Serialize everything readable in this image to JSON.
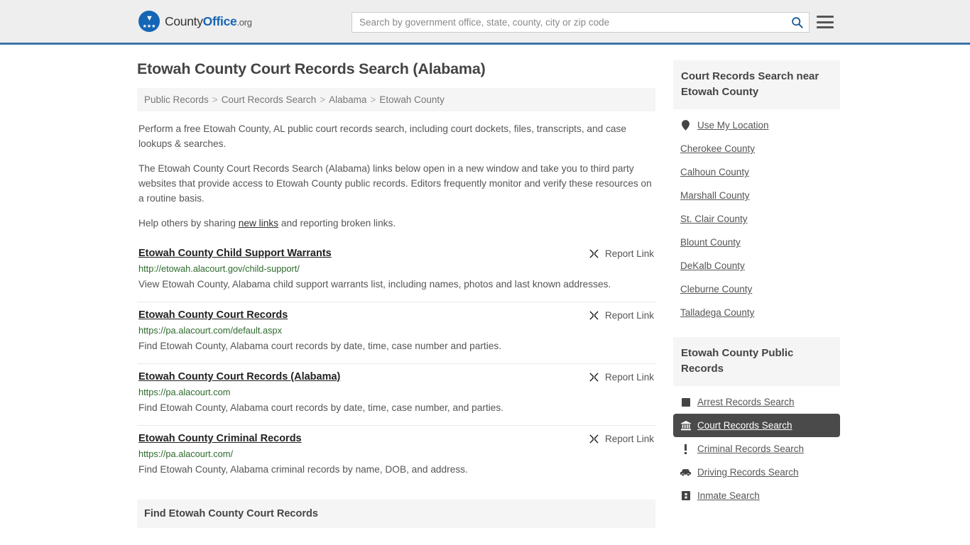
{
  "header": {
    "logo": {
      "icon": "eagle-seal-icon",
      "text_county": "County",
      "text_office": "Office",
      "text_org": ".org"
    },
    "search": {
      "placeholder": "Search by government office, state, county, city or zip code",
      "value": "",
      "icon": "search-icon"
    },
    "menu_icon": "hamburger-menu-icon",
    "accent_color": "#3b72a8"
  },
  "main": {
    "title": "Etowah County Court Records Search (Alabama)",
    "breadcrumb": [
      "Public Records",
      "Court Records Search",
      "Alabama",
      "Etowah County"
    ],
    "breadcrumb_separator": ">",
    "intro": [
      "Perform a free Etowah County, AL public court records search, including court dockets, files, transcripts, and case lookups & searches.",
      "The Etowah County Court Records Search (Alabama) links below open in a new window and take you to third party websites that provide access to Etowah County public records. Editors frequently monitor and verify these resources on a routine basis."
    ],
    "help_prefix": "Help others by sharing ",
    "help_link": "new links",
    "help_suffix": " and reporting broken links.",
    "report_label": "Report Link",
    "report_icon": "broken-link-icon",
    "results": [
      {
        "title": "Etowah County Child Support Warrants",
        "url": "http://etowah.alacourt.gov/child-support/",
        "description": "View Etowah County, Alabama child support warrants list, including names, photos and last known addresses."
      },
      {
        "title": "Etowah County Court Records",
        "url": "https://pa.alacourt.com/default.aspx",
        "description": "Find Etowah County, Alabama court records by date, time, case number and parties."
      },
      {
        "title": "Etowah County Court Records (Alabama)",
        "url": "https://pa.alacourt.com",
        "description": "Find Etowah County, Alabama court records by date, time, case number, and parties."
      },
      {
        "title": "Etowah County Criminal Records",
        "url": "https://pa.alacourt.com/",
        "description": "Find Etowah County, Alabama criminal records by name, DOB, and address."
      }
    ],
    "section_bar": "Find Etowah County Court Records"
  },
  "sidebar": {
    "nearby": {
      "heading": "Court Records Search near Etowah County",
      "items": [
        {
          "label": "Use My Location",
          "icon": "map-pin-icon"
        },
        {
          "label": "Cherokee County",
          "icon": ""
        },
        {
          "label": "Calhoun County",
          "icon": ""
        },
        {
          "label": "Marshall County",
          "icon": ""
        },
        {
          "label": "St. Clair County",
          "icon": ""
        },
        {
          "label": "Blount County",
          "icon": ""
        },
        {
          "label": "DeKalb County",
          "icon": ""
        },
        {
          "label": "Cleburne County",
          "icon": ""
        },
        {
          "label": "Talladega County",
          "icon": ""
        }
      ]
    },
    "public_records": {
      "heading": "Etowah County Public Records",
      "items": [
        {
          "label": "Arrest Records Search",
          "icon": "file-square-icon",
          "active": false
        },
        {
          "label": "Court Records Search",
          "icon": "courthouse-icon",
          "active": true
        },
        {
          "label": "Criminal Records Search",
          "icon": "exclamation-icon",
          "active": false
        },
        {
          "label": "Driving Records Search",
          "icon": "car-icon",
          "active": false
        },
        {
          "label": "Inmate Search",
          "icon": "prisoner-icon",
          "active": false
        }
      ]
    },
    "active_color": "#4a4a4a"
  }
}
